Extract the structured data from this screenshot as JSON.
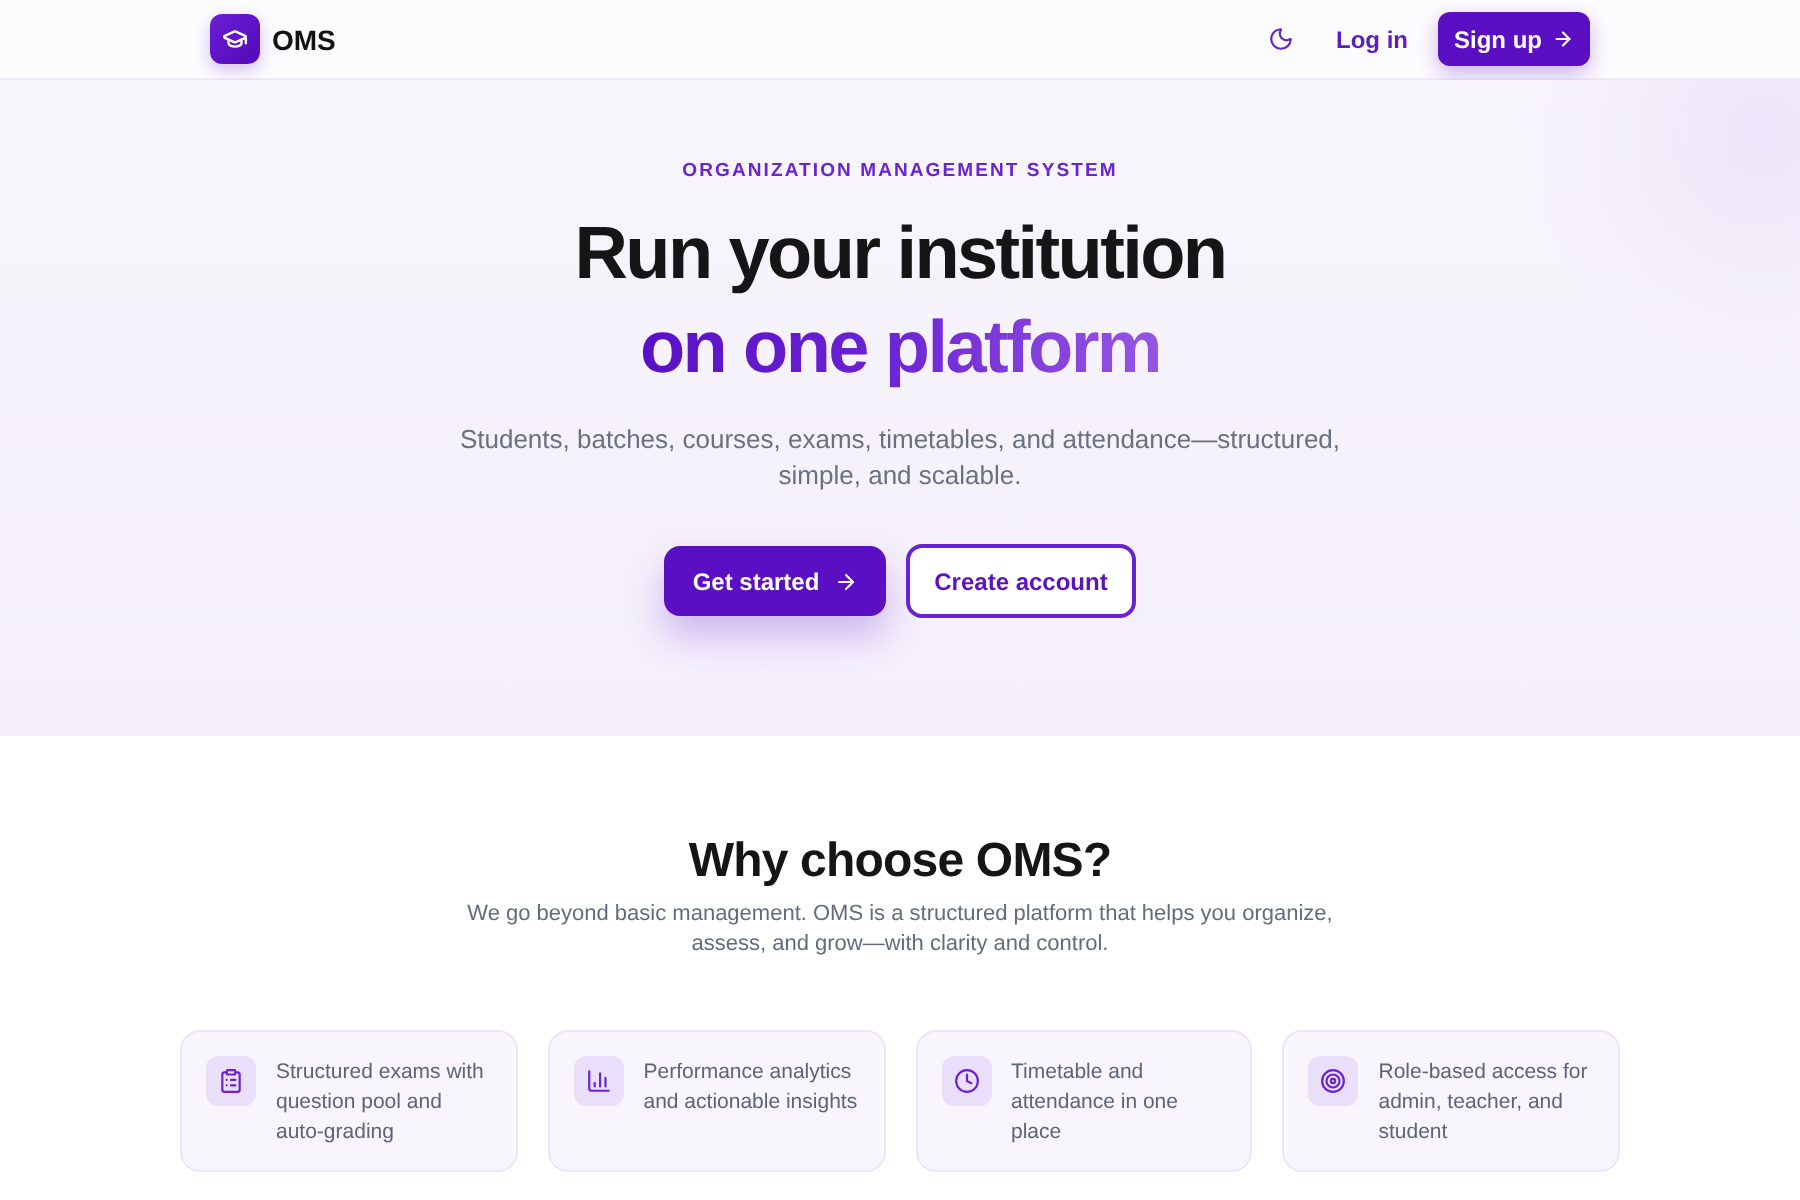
{
  "header": {
    "logo_text": "OMS",
    "login": "Log in",
    "signup": "Sign up"
  },
  "hero": {
    "eyebrow": "ORGANIZATION MANAGEMENT SYSTEM",
    "title_line_1": "Run your institution",
    "title_line_2": "on one platform",
    "subtitle": "Students, batches, courses, exams, timetables, and attendance—structured, simple, and scalable.",
    "buttons": [
      {
        "label": "Get started",
        "kind": "primary"
      },
      {
        "label": "Create account",
        "kind": "outline"
      }
    ]
  },
  "why": {
    "title": "Why choose OMS?",
    "text": "We go beyond basic management. OMS is a structured platform that helps you organize, assess, and grow—with clarity and control.",
    "features": [
      {
        "kind": "exams",
        "text": "Structured exams with question pool and auto-grading"
      },
      {
        "kind": "analytics",
        "text": "Performance analytics and actionable insights"
      },
      {
        "kind": "schedule",
        "text": "Timetable and attendance in one place"
      },
      {
        "kind": "roles",
        "text": "Role-based access for admin, teacher, and student"
      }
    ]
  }
}
